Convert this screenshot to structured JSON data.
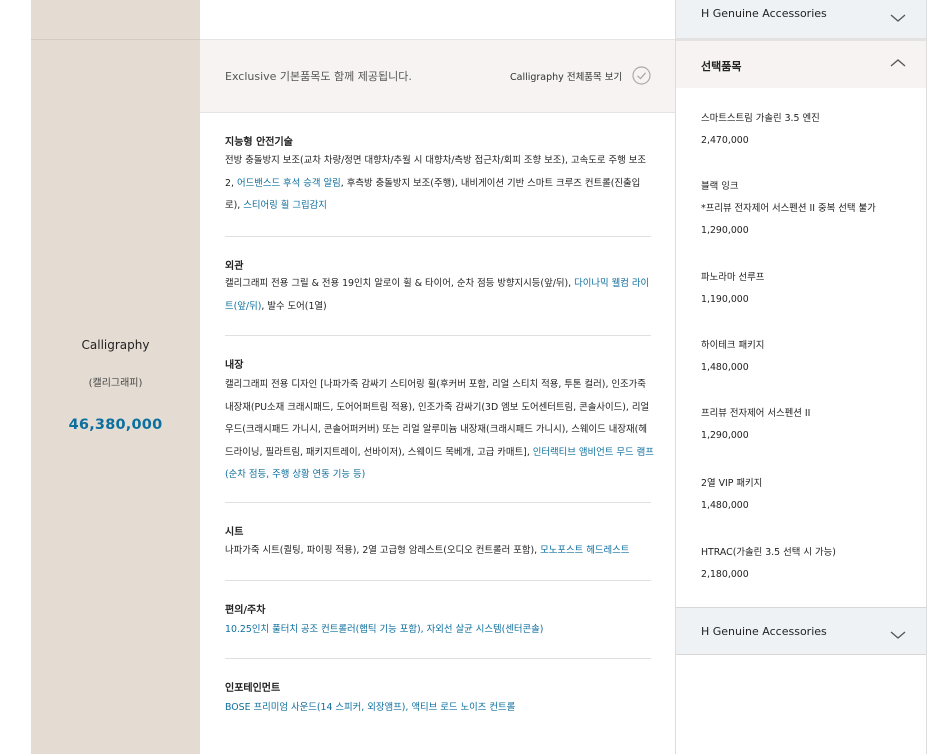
{
  "trim": {
    "name": "Calligraphy",
    "sub": "(캘리그래피)",
    "price": "46,380,000"
  },
  "intro": {
    "text": "Exclusive 기본품목도 함께 제공됩니다.",
    "link": "Calligraphy 전체품목 보기",
    "check_icon": "circle-check-icon"
  },
  "sections": [
    {
      "title": "지능형 안전기술",
      "body": [
        {
          "t": "전방 충돌방지 보조(교차 차량/정면 대향차/추월 시 대향차/측방 접근차/회피 조향 보조), 고속도로 주행 보조 2, "
        },
        {
          "t": "어드밴스드 후석 승객 알림",
          "link": true
        },
        {
          "t": ", 후측방 충돌방지 보조(주행), 내비게이션 기반 스마트 크루즈 컨트롤(진출입로), "
        },
        {
          "t": "스티어링 휠 그립감지",
          "link": true
        }
      ]
    },
    {
      "title": "외관",
      "body": [
        {
          "t": "캘리그래피 전용 그릴 & 전용 19인치 알로이 휠 & 타이어, 순차 점등 방향지시등(앞/뒤), "
        },
        {
          "t": "다이나믹 웰컴 라이트(앞/뒤)",
          "link": true
        },
        {
          "t": ", 발수 도어(1열)"
        }
      ]
    },
    {
      "title": "내장",
      "body": [
        {
          "t": "캘리그래피 전용 디자인 [나파가죽 감싸기 스티어링 휠(후커버 포함, 리얼 스티치 적용, 투톤 컬러), 인조가죽 내장재(PU소재 크래시패드, 도어어퍼트림 적용), 인조가죽 감싸기(3D 엠보 도어센터트림, 콘솔사이드), 리얼 우드(크래시패드 가니시, 콘솔어퍼커버) 또는 리얼 알루미늄 내장재(크래시패드 가니시), 스웨이드 내장재(헤드라이닝, 필라트림, 패키지트레이, 선바이저), 스웨이드 목베개, 고급 카매트], "
        },
        {
          "t": "인터랙티브 앰비언트 무드 램프(순차 점등, 주행 상황 연동 기능 등)",
          "link": true
        }
      ]
    },
    {
      "title": "시트",
      "body": [
        {
          "t": "나파가죽 시트(퀼팅, 파이핑 적용), 2열 고급형 암레스트(오디오 컨트롤러 포함), "
        },
        {
          "t": "모노포스트 헤드레스트",
          "link": true
        }
      ]
    },
    {
      "title": "편의/주차",
      "body": [
        {
          "t": "10.25인치 풀터치 공조 컨트롤러(햅틱 기능 포함), 자외선 살균 시스템(센터콘솔)",
          "link": true
        }
      ]
    },
    {
      "title": "인포테인먼트",
      "body": [
        {
          "t": "BOSE 프리미엄 사운드(14 스피커, 외장앰프), 액티브 로드 노이즈 컨트롤",
          "link": true
        }
      ]
    }
  ],
  "options_panel": {
    "top_accordion": "H Genuine Accessories",
    "selected_header": "선택품목",
    "items": [
      {
        "name": "스마트스트림 가솔린 3.5 엔진",
        "note": "",
        "price": "2,470,000"
      },
      {
        "name": "블랙 잉크",
        "note": "*프리뷰 전자제어 서스펜션 II 중복 선택 불가",
        "price": "1,290,000"
      },
      {
        "name": "파노라마 선루프",
        "note": "",
        "price": "1,190,000"
      },
      {
        "name": "하이테크 패키지",
        "note": "",
        "price": "1,480,000"
      },
      {
        "name": "프리뷰 전자제어 서스펜션 II",
        "note": "",
        "price": "1,290,000"
      },
      {
        "name": "2열 VIP 패키지",
        "note": "",
        "price": "1,480,000"
      },
      {
        "name": "HTRAC(가솔린 3.5 선택 시 가능)",
        "note": "",
        "price": "2,180,000"
      }
    ],
    "bottom_accordion": "H Genuine Accessories",
    "chevron_icons": [
      "chevron-down-icon",
      "chevron-up-icon"
    ]
  }
}
